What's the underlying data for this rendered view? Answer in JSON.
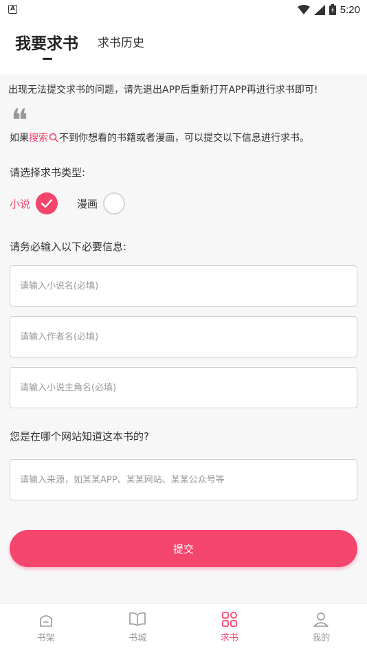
{
  "statusbar": {
    "time": "5:20",
    "left_badge": "A"
  },
  "header": {
    "tab_request": "我要求书",
    "tab_history": "求书历史"
  },
  "notice": "出现无法提交求书的问题，请先退出APP后重新打开APP再进行求书即可!",
  "intro": {
    "prefix": "如果",
    "highlight": "搜索",
    "suffix": "不到你想看的书籍或者漫画，可以提交以下信息进行求书。"
  },
  "type_section": {
    "label": "请选择求书类型:",
    "options": [
      {
        "label": "小说",
        "selected": true
      },
      {
        "label": "漫画",
        "selected": false
      }
    ]
  },
  "info_section": {
    "label": "请务必输入以下必要信息:"
  },
  "fields": {
    "novel_name": {
      "placeholder": "请输入小说名(必填)",
      "value": ""
    },
    "author_name": {
      "placeholder": "请输入作者名(必填)",
      "value": ""
    },
    "protagonist_name": {
      "placeholder": "请输入小说主角名(必填)",
      "value": ""
    },
    "source": {
      "placeholder": "请输入来源，如某某APP、某某网站、某某公众号等",
      "value": ""
    }
  },
  "source_section": {
    "label": "您是在哪个网站知道这本书的?"
  },
  "submit_label": "提交",
  "bottom_nav": [
    {
      "label": "书架",
      "icon": "bookshelf-icon",
      "active": false
    },
    {
      "label": "书城",
      "icon": "open-book-icon",
      "active": false
    },
    {
      "label": "求书",
      "icon": "grid-icon",
      "active": true
    },
    {
      "label": "我的",
      "icon": "user-icon",
      "active": false
    }
  ],
  "colors": {
    "accent": "#f4456d",
    "text": "#333333",
    "muted": "#999999",
    "border": "#cfcfcf"
  }
}
